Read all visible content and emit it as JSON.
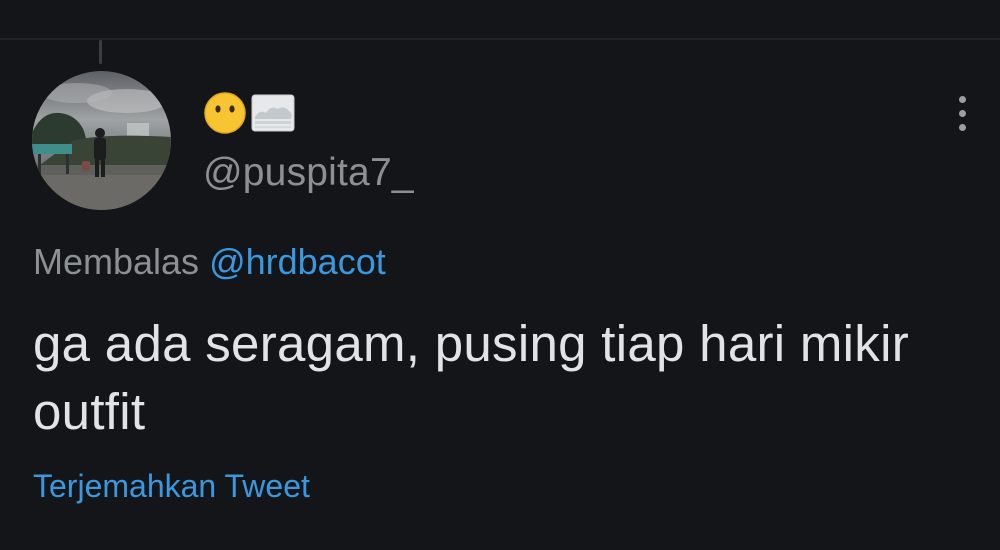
{
  "tweet": {
    "display_name_emojis": [
      "neutral-face-emoji",
      "fog-emoji"
    ],
    "username": "@puspita7_",
    "reply_prefix": "Membalas",
    "reply_mention": "@hrdbacot",
    "text": "ga ada seragam, pusing tiap hari mikir outfit",
    "translate_label": "Terjemahkan Tweet"
  },
  "icons": {
    "more": "more-vertical-icon"
  },
  "colors": {
    "background": "#141518",
    "text_primary": "#e1e4e7",
    "text_secondary": "#8b9095",
    "accent_link": "#3a98e0"
  }
}
